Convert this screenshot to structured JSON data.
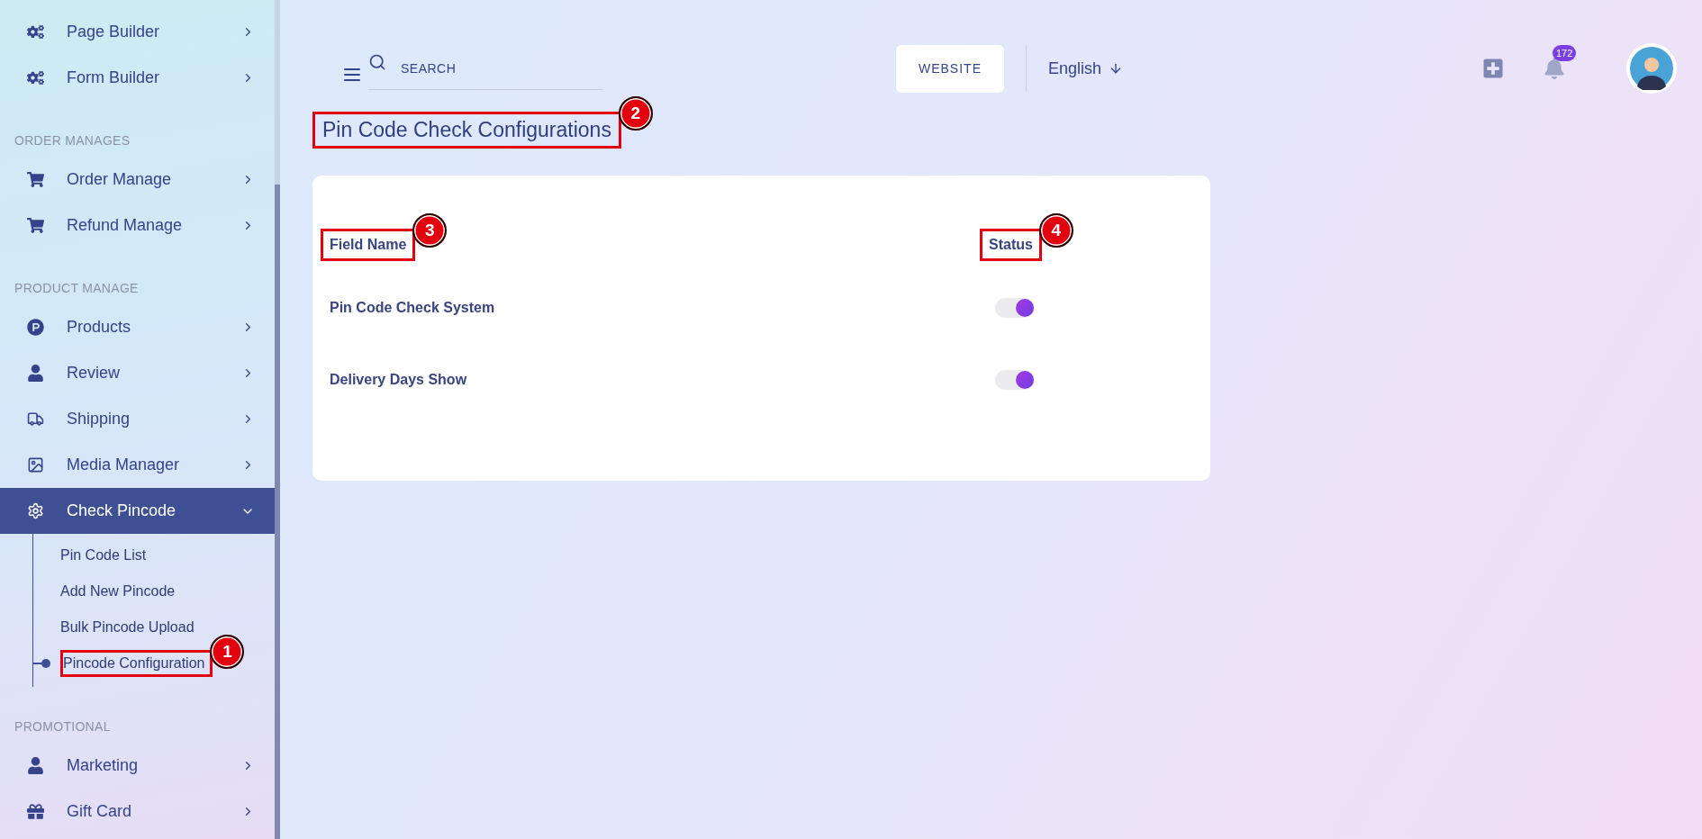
{
  "sidebar": {
    "sections": [
      {
        "items": [
          {
            "label": "Page Builder",
            "expanded": false,
            "selected": false
          },
          {
            "label": "Form Builder",
            "expanded": false,
            "selected": false
          }
        ]
      },
      {
        "heading": "ORDER MANAGES",
        "items": [
          {
            "label": "Order Manage",
            "expanded": false,
            "selected": false
          },
          {
            "label": "Refund Manage",
            "expanded": false,
            "selected": false
          }
        ]
      },
      {
        "heading": "PRODUCT MANAGE",
        "items": [
          {
            "label": "Products",
            "expanded": false,
            "selected": false
          },
          {
            "label": "Review",
            "expanded": false,
            "selected": false
          },
          {
            "label": "Shipping",
            "expanded": false,
            "selected": false
          },
          {
            "label": "Media Manager",
            "expanded": false,
            "selected": false
          },
          {
            "label": "Check Pincode",
            "expanded": true,
            "selected": true,
            "children": [
              {
                "label": "Pin Code List",
                "selected": false
              },
              {
                "label": "Add New Pincode",
                "selected": false
              },
              {
                "label": "Bulk Pincode Upload",
                "selected": false
              },
              {
                "label": "Pincode Configuration",
                "selected": true,
                "callout": "1"
              }
            ]
          }
        ]
      },
      {
        "heading": "PROMOTIONAL",
        "items": [
          {
            "label": "Marketing",
            "expanded": false,
            "selected": false
          },
          {
            "label": "Gift Card",
            "expanded": false,
            "selected": false
          }
        ]
      }
    ]
  },
  "header": {
    "search": {
      "placeholder": "SEARCH"
    },
    "website_button": "WEBSITE",
    "language": "English",
    "notifications": "172"
  },
  "page": {
    "title": "Pin Code Check Configurations",
    "title_callout": "2"
  },
  "table": {
    "columns": [
      {
        "label": "Field Name",
        "callout": "3"
      },
      {
        "label": "Status",
        "callout": "4"
      }
    ],
    "rows": [
      {
        "name": "Pin Code Check System",
        "on": true
      },
      {
        "name": "Delivery Days Show",
        "on": true
      }
    ]
  }
}
